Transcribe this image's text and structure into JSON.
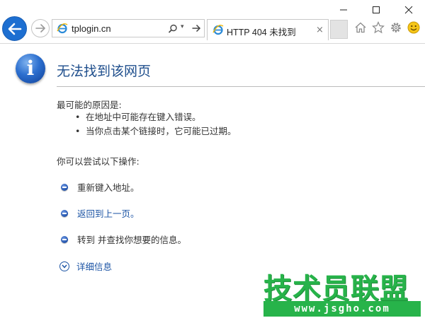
{
  "window": {
    "minimize_icon": "minimize-icon",
    "maximize_icon": "maximize-icon",
    "close_icon": "close-icon"
  },
  "nav": {
    "back_icon": "back-arrow-icon",
    "forward_icon": "forward-arrow-icon"
  },
  "address_bar": {
    "url": "tplogin.cn",
    "search_icon": "search-icon",
    "dropdown_glyph": "▾",
    "go_icon": "go-arrow-icon"
  },
  "tab": {
    "title": "HTTP 404 未找到",
    "close_glyph": "×"
  },
  "toolbar": {
    "home_icon": "home-icon",
    "favorites_icon": "star-icon",
    "tools_icon": "gear-icon",
    "feedback_icon": "smiley-icon"
  },
  "page": {
    "title": "无法找到该网页",
    "reasons_heading": "最可能的原因是:",
    "reasons": [
      "在地址中可能存在键入错误。",
      "当你点击某个链接时，它可能已过期。"
    ],
    "actions_heading": "你可以尝试以下操作:",
    "actions": [
      "重新键入地址。",
      "返回到上一页。",
      "转到  并查找你想要的信息。"
    ],
    "details_label": "详细信息"
  },
  "watermark": {
    "title": "技术员联盟",
    "url": "www.jsgho.com"
  },
  "colors": {
    "accent_blue": "#1d6fd1",
    "title_blue": "#1e4e8c",
    "link_blue": "#1d55a5",
    "watermark_green": "#27b34a"
  }
}
